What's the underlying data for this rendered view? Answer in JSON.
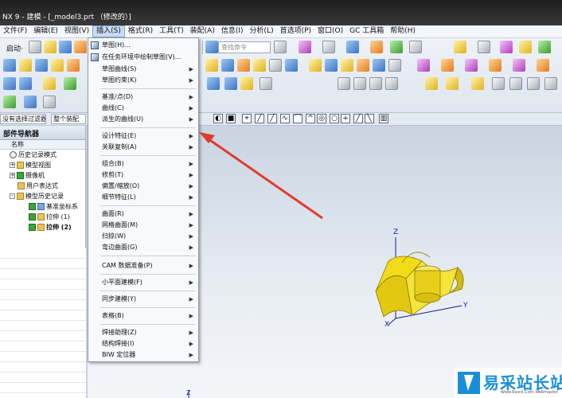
{
  "window": {
    "title": "NX 9 - 建模 - [_model3.prt （修改的）]"
  },
  "menubar": {
    "items": [
      {
        "label": "文件(F)",
        "active": false
      },
      {
        "label": "编辑(E)",
        "active": false
      },
      {
        "label": "视图(V)",
        "active": false
      },
      {
        "label": "插入(S)",
        "active": true
      },
      {
        "label": "格式(R)",
        "active": false
      },
      {
        "label": "工具(T)",
        "active": false
      },
      {
        "label": "装配(A)",
        "active": false
      },
      {
        "label": "信息(I)",
        "active": false
      },
      {
        "label": "分析(L)",
        "active": false
      },
      {
        "label": "首选项(P)",
        "active": false
      },
      {
        "label": "窗口(O)",
        "active": false
      },
      {
        "label": "GC 工具箱",
        "active": false
      },
      {
        "label": "帮助(H)",
        "active": false
      }
    ]
  },
  "toolbar": {
    "start_label": "启动·",
    "search_placeholder": "查找命令"
  },
  "selection_bar": {
    "filter_label": "没有选择过滤器",
    "scope_label": "整个装配"
  },
  "navigator": {
    "title": "部件导航器",
    "column_name": "名称",
    "items": [
      {
        "label": "历史记录模式",
        "icon": "clock-icon",
        "indent": 1,
        "expander": ""
      },
      {
        "label": "模型视图",
        "icon": "folder-icon",
        "indent": 0,
        "expander": "+"
      },
      {
        "label": "摄像机",
        "icon": "camera-icon",
        "indent": 0,
        "expander": "+"
      },
      {
        "label": "用户表达式",
        "icon": "folder-icon",
        "indent": 1,
        "expander": ""
      },
      {
        "label": "模型历史记录",
        "icon": "folder-icon",
        "indent": 0,
        "expander": "-"
      },
      {
        "label": "基准坐标系",
        "icon": "check-icon",
        "indent": 2,
        "expander": ""
      },
      {
        "label": "拉伸 (1)",
        "icon": "check-icon",
        "indent": 2,
        "expander": ""
      },
      {
        "label": "拉伸 (2)",
        "icon": "check-icon",
        "indent": 2,
        "expander": "",
        "bold": true
      }
    ]
  },
  "insert_menu": {
    "items": [
      {
        "label": "草图(H)...",
        "submenu": false,
        "icon": true
      },
      {
        "label": "在任务环境中绘制草图(V)...",
        "submenu": false,
        "icon": true
      },
      {
        "label": "草图曲线(S)",
        "submenu": true
      },
      {
        "label": "草图约束(K)",
        "submenu": true
      },
      {
        "label": "基准/点(D)",
        "submenu": true
      },
      {
        "label": "曲线(C)",
        "submenu": true
      },
      {
        "label": "派生的曲线(U)",
        "submenu": true
      },
      {
        "label": "设计特征(E)",
        "submenu": true
      },
      {
        "label": "关联复制(A)",
        "submenu": true
      },
      {
        "label": "组合(B)",
        "submenu": true
      },
      {
        "label": "修剪(T)",
        "submenu": true
      },
      {
        "label": "偏置/缩放(O)",
        "submenu": true
      },
      {
        "label": "细节特征(L)",
        "submenu": true
      },
      {
        "label": "曲面(R)",
        "submenu": true
      },
      {
        "label": "网格曲面(M)",
        "submenu": true
      },
      {
        "label": "扫掠(W)",
        "submenu": true
      },
      {
        "label": "弯边曲面(G)",
        "submenu": true
      },
      {
        "label": "CAM 数据准备(P)",
        "submenu": true
      },
      {
        "label": "小平面建模(F)",
        "submenu": true
      },
      {
        "label": "同步建模(Y)",
        "submenu": true
      },
      {
        "label": "表格(B)",
        "submenu": true
      },
      {
        "label": "焊接助理(Z)",
        "submenu": true
      },
      {
        "label": "结构焊接(I)",
        "submenu": true
      },
      {
        "label": "BIW 定位器",
        "submenu": true
      }
    ]
  },
  "graphics": {
    "axis_labels": [
      "Z",
      "Y",
      "X",
      "Z"
    ]
  },
  "watermark": {
    "brand": "易采站长站",
    "url": "Www.Easck.Com Webmaster"
  },
  "colors": {
    "accent": "#1a8fd8",
    "model": "#e8d010",
    "arrow": "#e23b2e"
  }
}
